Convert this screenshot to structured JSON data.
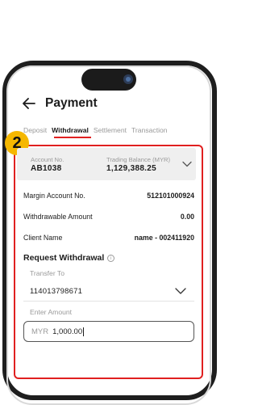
{
  "header": {
    "title": "Payment"
  },
  "tabs": [
    {
      "label": "Deposit",
      "active": false
    },
    {
      "label": "Withdrawal",
      "active": true
    },
    {
      "label": "Settlement",
      "active": false
    },
    {
      "label": "Transaction",
      "active": false
    }
  ],
  "step_badge": "2",
  "account_card": {
    "account_label": "Account No.",
    "account_value": "AB1038",
    "balance_label": "Trading Balance (MYR)",
    "balance_value": "1,129,388.25"
  },
  "info": [
    {
      "label": "Margin Account No.",
      "value": "512101000924"
    },
    {
      "label": "Withdrawable Amount",
      "value": "0.00"
    },
    {
      "label": "Client Name",
      "value": "name - 002411920"
    }
  ],
  "request": {
    "title": "Request Withdrawal",
    "transfer_to_label": "Transfer To",
    "transfer_to_value": "114013798671",
    "amount_label": "Enter Amount",
    "amount_prefix": "MYR",
    "amount_value": "1,000.00"
  },
  "colors": {
    "accent_red": "#e02020",
    "badge_yellow": "#f5b700",
    "camera_blue": "#2d3c57"
  },
  "icons": [
    "back-arrow-icon",
    "chevron-down-icon",
    "info-icon"
  ]
}
